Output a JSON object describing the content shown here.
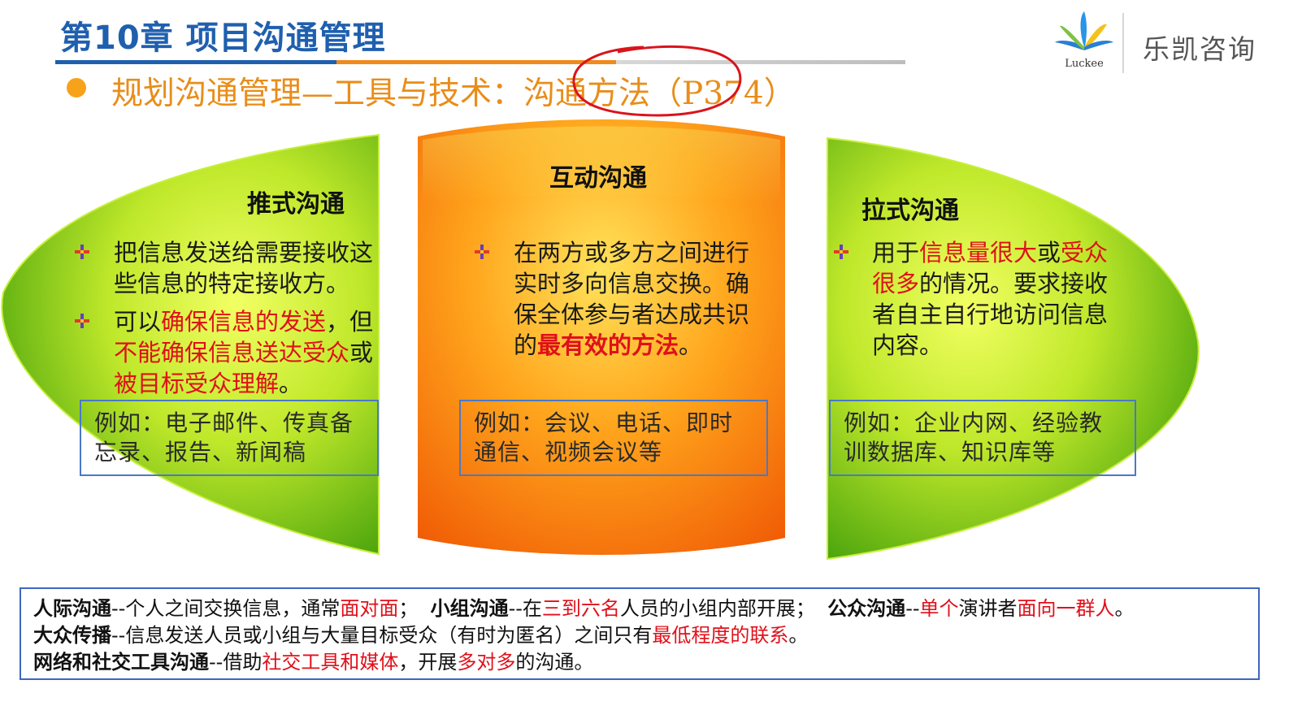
{
  "header": {
    "chapter_title": "第10章 项目沟通管理",
    "rule_colors": [
      "#1f5fae",
      "#f08a1c",
      "#c9c9c9"
    ],
    "brand_mark_icon": "luckee-fan-logo-icon",
    "brand_mark_text": "Luckee",
    "brand_name": "乐凯咨询",
    "subtitle_prefix": "规划沟通管理—工具与技术：",
    "subtitle_highlight": "沟通方法",
    "subtitle_suffix": "（P374）",
    "subtitle_color": "#e98d19"
  },
  "panels": {
    "push": {
      "title": "推式沟通",
      "item1": "把信息发送给需要接收这些信息的特定接收方。",
      "item2_a": "可以",
      "item2_b": "确保信息的发送",
      "item2_c": "，但",
      "item2_d": "不能确保信息送达受众",
      "item2_e": "或",
      "item2_f": "被目标受众理解",
      "item2_g": "。",
      "example": "例如：电子邮件、传真备忘录、报告、新闻稿"
    },
    "interactive": {
      "title": "互动沟通",
      "item1_a": "在两方或多方之间进行实时多向信息交换。确保全体参与者达成共识的",
      "item1_b": "最有效的方法",
      "item1_c": "。",
      "example": "例如：会议、电话、即时通信、视频会议等"
    },
    "pull": {
      "title": "拉式沟通",
      "item1_a": "用于",
      "item1_b": "信息量很大",
      "item1_c": "或",
      "item1_d": "受众很多",
      "item1_e": "的情况。要求接收者自主自行地访问信息内容。",
      "example": "例如：企业内网、经验教训数据库、知识库等"
    }
  },
  "bottom": {
    "l1_a": "人际沟通",
    "l1_b": "--个人之间交换信息，通常",
    "l1_c": "面对面",
    "l1_d": "；  ",
    "l1_e": "小组沟通",
    "l1_f": "--在",
    "l1_g": "三到六名",
    "l1_h": "人员的小组内部开展；  ",
    "l1_i": "公众沟通",
    "l1_j": "--",
    "l1_k": "单个",
    "l1_l": "演讲者",
    "l1_m": "面向一群人",
    "l1_n": "。",
    "l2_a": "大众传播",
    "l2_b": "--信息发送人员或小组与大量目标受众（有时为匿名）之间只有",
    "l2_c": "最低程度的联系",
    "l2_d": "。",
    "l3_a": "网络和社交工具沟通",
    "l3_b": "--借助",
    "l3_c": "社交工具和媒体",
    "l3_d": "，开展",
    "l3_e": "多对多",
    "l3_f": "的沟通。"
  },
  "colors": {
    "green_light": "#e8ff4a",
    "green_dark": "#3c9a08",
    "orange_light": "#ffd84a",
    "orange_dark": "#f26a06",
    "red_text": "#e0101a",
    "box_border": "#4a79c8"
  }
}
